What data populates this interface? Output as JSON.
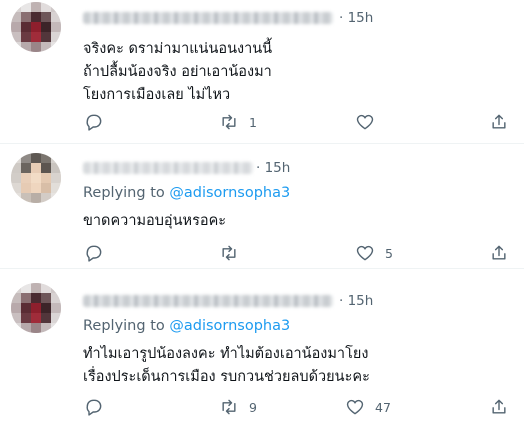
{
  "tweets": [
    {
      "time": "· 15h",
      "replying_prefix": "",
      "replying_handle": "",
      "lines": [
        "จริงคะ ดราม่ามาแน่นอนงานนี้",
        "ถ้าปลื้มน้องจริง อย่าเอาน้องมา",
        "โยงการเมืองเลย ไม่ไหว"
      ],
      "counts": {
        "reply": "",
        "retweet": "1",
        "like": ""
      }
    },
    {
      "time": "· 15h",
      "replying_prefix": "Replying to ",
      "replying_handle": "@adisornsopha3",
      "lines": [
        "ขาดความอบอุ่นหรอคะ"
      ],
      "counts": {
        "reply": "",
        "retweet": "",
        "like": "5"
      }
    },
    {
      "time": "· 15h",
      "replying_prefix": "Replying to ",
      "replying_handle": "@adisornsopha3",
      "lines": [
        "ทำไมเอารูปน้องลงคะ ทำไมต้องเอาน้องมาโยง",
        "เรื่องประเด็นการเมือง รบกวนช่วยลบด้วยนะคะ"
      ],
      "counts": {
        "reply": "",
        "retweet": "9",
        "like": "47"
      }
    }
  ],
  "icons": [
    "reply-icon",
    "retweet-icon",
    "like-icon",
    "share-icon"
  ],
  "colors": {
    "text": "#0f1419",
    "secondary": "#536471",
    "link": "#1d9bf0",
    "divider": "#eff3f4"
  }
}
